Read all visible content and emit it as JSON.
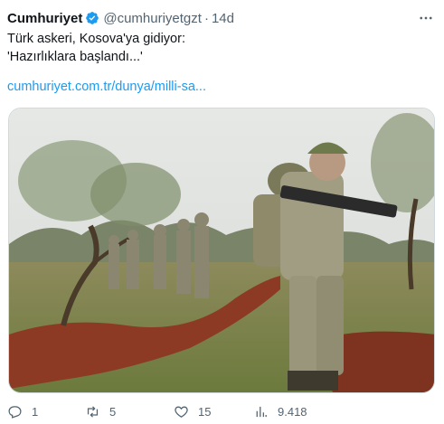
{
  "author": {
    "display_name": "Cumhuriyet",
    "handle": "@cumhuriyetgzt",
    "separator": "·",
    "time": "14d"
  },
  "tweet": {
    "line1": "Türk askeri, Kosova'ya gidiyor:",
    "line2": "'Hazırlıklara başlandı...'",
    "link": "cumhuriyet.com.tr/dunya/milli-sa..."
  },
  "actions": {
    "replies": "1",
    "retweets": "5",
    "likes": "15",
    "views": "9.418"
  },
  "colors": {
    "verified": "#1d9bf0",
    "link": "#1d9bf0",
    "muted": "#536471"
  },
  "icons": [
    "verified-badge-icon",
    "more-options-icon",
    "reply-icon",
    "retweet-icon",
    "like-icon",
    "views-icon"
  ]
}
